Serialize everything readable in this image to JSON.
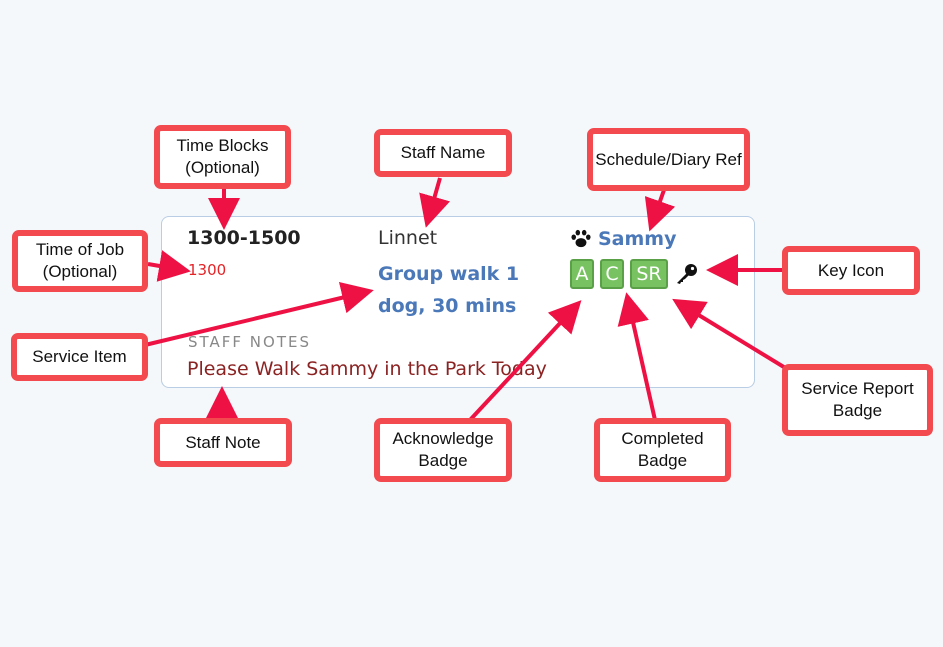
{
  "card": {
    "time_block": "1300-1500",
    "job_time": "1300",
    "staff_name": "Linnet",
    "service_item": "Group walk 1 dog, 30 mins",
    "staff_notes_label": "STAFF NOTES",
    "staff_note": "Please Walk Sammy in the Park Today",
    "schedule_ref": "Sammy",
    "badges": {
      "acknowledge": "A",
      "completed": "C",
      "service_report": "SR"
    }
  },
  "callouts": {
    "time_blocks": "Time Blocks (Optional)",
    "time_of_job": "Time of Job (Optional)",
    "staff_name": "Staff Name",
    "schedule_ref": "Schedule/Diary Ref",
    "key_icon": "Key Icon",
    "service_item": "Service Item",
    "staff_note": "Staff Note",
    "acknowledge_badge": "Acknowledge Badge",
    "completed_badge": "Completed Badge",
    "service_report_badge": "Service Report Badge"
  },
  "colors": {
    "callout_border": "#f24a4e",
    "arrow": "#ee1144",
    "badge_green": "#78c262",
    "link_blue": "#4a78b8",
    "note_red": "#8b2323",
    "job_time_red": "#e52326"
  }
}
